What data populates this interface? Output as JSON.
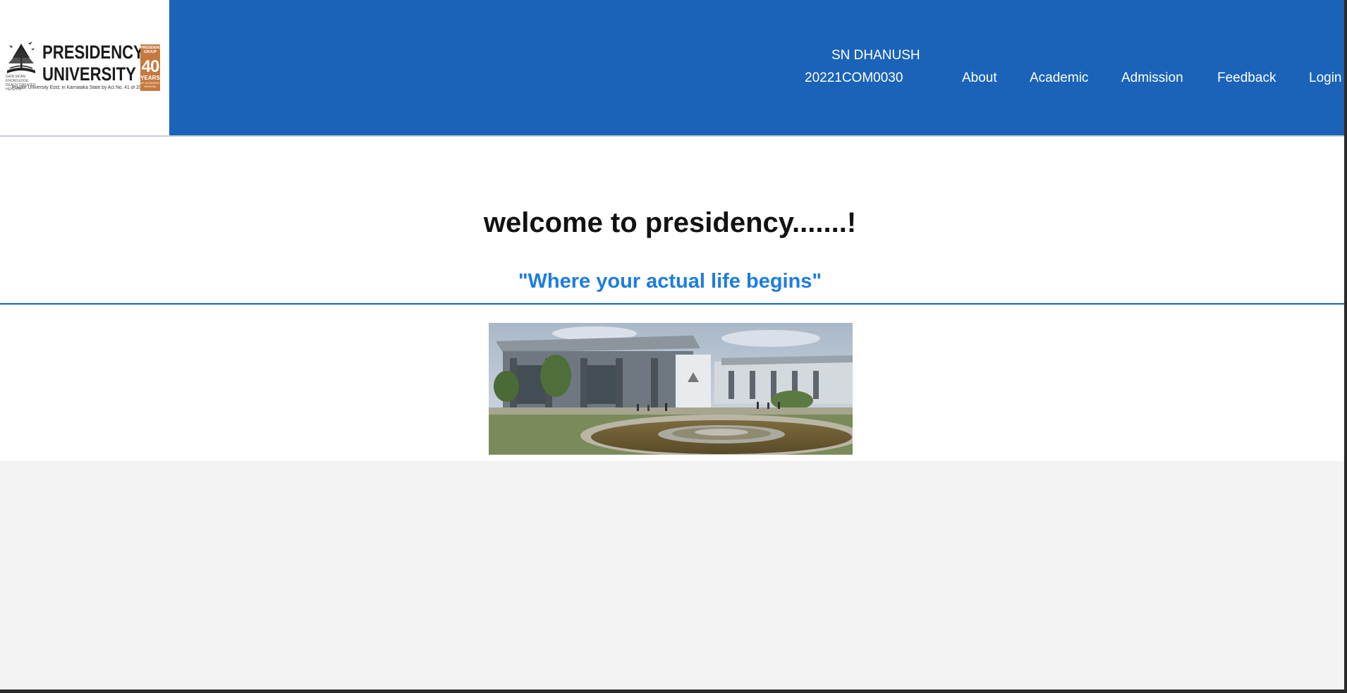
{
  "header": {
    "logo": {
      "line1": "PRESIDENCY",
      "line2": "UNIVERSITY",
      "caption": "Private University Estd. in Karnataka State by Act No. 41 of 2013",
      "tagline": "GAIN MORE KNOWLEDGE\nREACH GREATER HEIGHTS",
      "badge": {
        "top": "PRESIDENCY GROUP",
        "number": "40",
        "years": "YEARS",
        "sub": "OF ACADEMIC WISDOM"
      }
    },
    "user": {
      "name": "SN DHANUSH",
      "id": "20221COM0030"
    },
    "nav": {
      "about": "About",
      "academic": "Academic",
      "admission": "Admission",
      "feedback": "Feedback",
      "login": "Login"
    },
    "colors": {
      "header_bg": "#1a63b9",
      "accent": "#1d7ce0",
      "badge": "#c6783e"
    }
  },
  "main": {
    "welcome": "welcome to presidency.......!",
    "tagline": "\"Where your actual life begins\"",
    "image": "campus-photo"
  }
}
